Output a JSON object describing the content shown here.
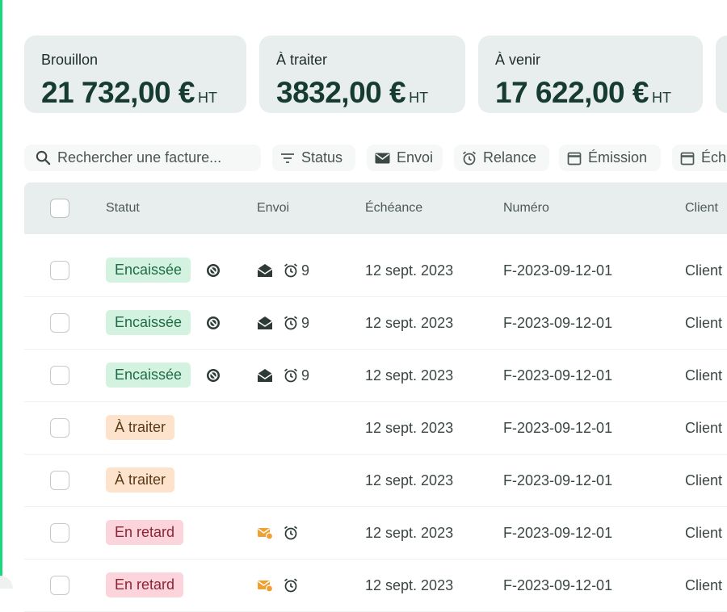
{
  "summary_cards": [
    {
      "label": "Brouillon",
      "amount": "21 732,00 €",
      "unit": "HT"
    },
    {
      "label": "À traiter",
      "amount": "3832,00 €",
      "unit": "HT"
    },
    {
      "label": "À venir",
      "amount": "17 622,00 €",
      "unit": "HT"
    }
  ],
  "filters": {
    "search_placeholder": "Rechercher une facture...",
    "status": "Status",
    "envoi": "Envoi",
    "relance": "Relance",
    "emission": "Émission",
    "echeance": "Éch"
  },
  "table": {
    "columns": {
      "statut": "Statut",
      "envoi": "Envoi",
      "echeance": "Échéance",
      "numero": "Numéro",
      "client": "Client"
    },
    "rows": [
      {
        "status": "Encaissée",
        "status_type": "paid",
        "envoi_count": "9",
        "echeance": "12 sept. 2023",
        "numero": "F-2023-09-12-01",
        "client": "Client"
      },
      {
        "status": "Encaissée",
        "status_type": "paid",
        "envoi_count": "9",
        "echeance": "12 sept. 2023",
        "numero": "F-2023-09-12-01",
        "client": "Client"
      },
      {
        "status": "Encaissée",
        "status_type": "paid",
        "envoi_count": "9",
        "echeance": "12 sept. 2023",
        "numero": "F-2023-09-12-01",
        "client": "Client"
      },
      {
        "status": "À traiter",
        "status_type": "todo",
        "envoi_count": "",
        "echeance": "12 sept. 2023",
        "numero": "F-2023-09-12-01",
        "client": "Client"
      },
      {
        "status": "À traiter",
        "status_type": "todo",
        "envoi_count": "",
        "echeance": "12 sept. 2023",
        "numero": "F-2023-09-12-01",
        "client": "Client"
      },
      {
        "status": "En retard",
        "status_type": "late",
        "envoi_count": "",
        "echeance": "12 sept. 2023",
        "numero": "F-2023-09-12-01",
        "client": "Client"
      },
      {
        "status": "En retard",
        "status_type": "late",
        "envoi_count": "",
        "echeance": "12 sept. 2023",
        "numero": "F-2023-09-12-01",
        "client": "Client"
      }
    ]
  },
  "colors": {
    "accent": "#19d97a",
    "paid_bg": "#d3f3e0",
    "todo_bg": "#fde3cc",
    "late_bg": "#fcd4dc",
    "late_icon": "#f0a030"
  },
  "icons": {
    "search": "search-icon",
    "status_filter": "filter-lines-icon",
    "envoi_filter": "envelope-icon",
    "relance_filter": "alarm-clock-icon",
    "emission_filter": "calendar-icon",
    "paid_marker": "blocked-circle-icon",
    "sent": "envelope-open-icon",
    "reminder": "alarm-clock-icon",
    "late_mail": "mail-warning-icon"
  }
}
